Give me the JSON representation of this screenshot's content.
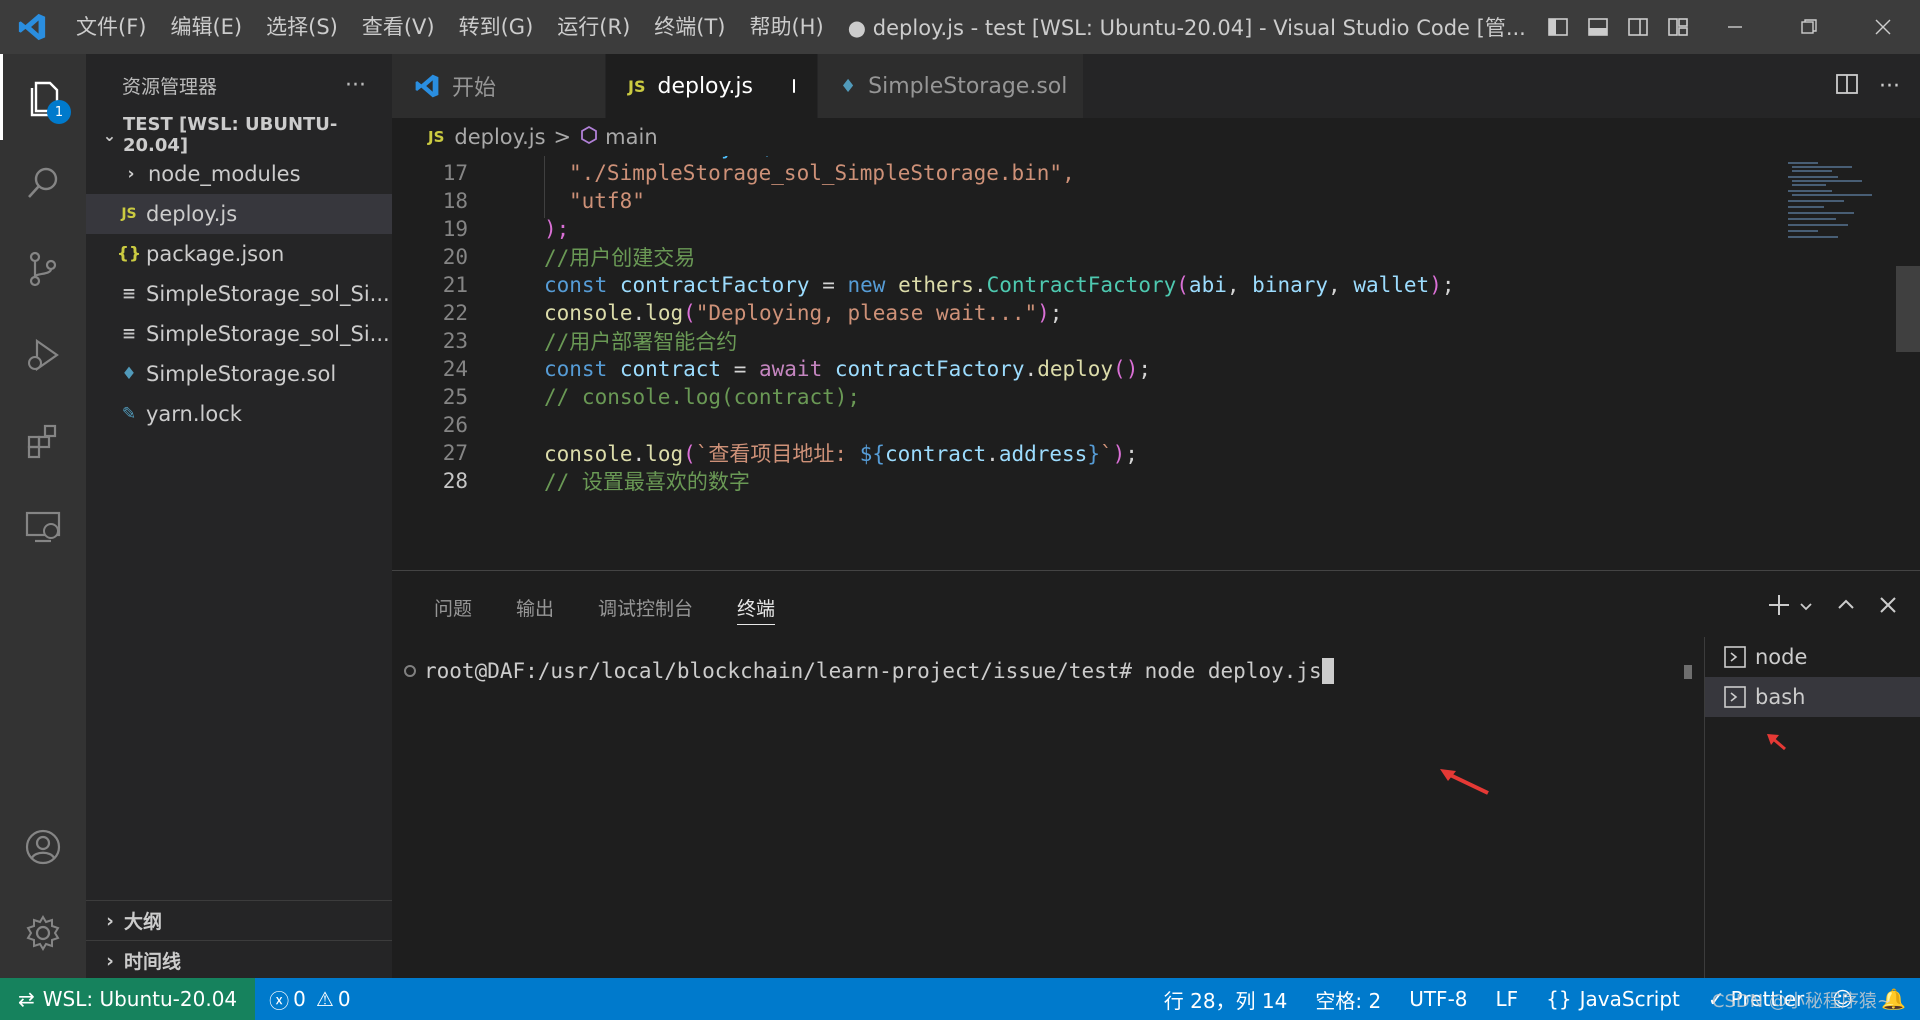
{
  "title_bar": {
    "menus": [
      "文件(F)",
      "编辑(E)",
      "选择(S)",
      "查看(V)",
      "转到(G)",
      "运行(R)",
      "终端(T)",
      "帮助(H)"
    ],
    "title": "● deploy.js - test [WSL: Ubuntu-20.04] - Visual Studio Code [管..."
  },
  "activity_bar": {
    "explorer_badge": "1"
  },
  "sidebar": {
    "header": "资源管理器",
    "more": "···",
    "section": "TEST [WSL: UBUNTU-20.04]",
    "files": [
      {
        "icon": "chevron-right-icon",
        "label": "node_modules"
      },
      {
        "icon": "js-file-icon",
        "label": "deploy.js"
      },
      {
        "icon": "json-file-icon",
        "label": "package.json"
      },
      {
        "icon": "text-file-icon",
        "label": "SimpleStorage_sol_Si..."
      },
      {
        "icon": "text-file-icon",
        "label": "SimpleStorage_sol_Si..."
      },
      {
        "icon": "ethereum-file-icon",
        "label": "SimpleStorage.sol"
      },
      {
        "icon": "yarn-file-icon",
        "label": "yarn.lock"
      }
    ],
    "outline": "大纲",
    "timeline": "时间线"
  },
  "tabs": [
    {
      "label": "开始",
      "icon": "vscode-logo-icon"
    },
    {
      "label": "deploy.js",
      "icon": "js-icon",
      "icon_text": "JS"
    },
    {
      "label": "SimpleStorage.sol",
      "icon": "ethereum-icon"
    }
  ],
  "breadcrumb": {
    "file_icon_text": "JS",
    "file": "deploy.js",
    "separator": ">",
    "symbol": "main"
  },
  "editor": {
    "lines": [
      {
        "n": "17",
        "text": "\"./SimpleStorage_sol_SimpleStorage.bin\","
      },
      {
        "n": "18",
        "text": "\"utf8\""
      },
      {
        "n": "19",
        "text": ");"
      },
      {
        "n": "20",
        "text": "//用户创建交易"
      },
      {
        "n": "21",
        "text": "const contractFactory = new ethers.ContractFactory(abi, binary, wallet);"
      },
      {
        "n": "22",
        "text": "console.log(\"Deploying, please wait...\");"
      },
      {
        "n": "23",
        "text": "//用户部署智能合约"
      },
      {
        "n": "24",
        "text": "const contract = await contractFactory.deploy();"
      },
      {
        "n": "25",
        "text": "// console.log(contract);"
      },
      {
        "n": "26",
        "text": ""
      },
      {
        "n": "27",
        "text": "console.log(`查看项目地址: ${contract.address}`);"
      },
      {
        "n": "28",
        "text": "// 设置最喜欢的数字"
      }
    ],
    "current_line": "28"
  },
  "panel": {
    "tabs": [
      "问题",
      "输出",
      "调试控制台",
      "终端"
    ],
    "active_tab": "终端",
    "terminal_prompt": "root@DAF:/usr/local/blockchain/learn-project/issue/test# ",
    "terminal_command": "node deploy.js",
    "terminals": [
      "node",
      "bash"
    ],
    "selected_terminal": "bash"
  },
  "status_bar": {
    "remote": "WSL: Ubuntu-20.04",
    "errors": "0",
    "warnings": "0",
    "position": "行 28，列 14",
    "spaces": "空格: 2",
    "encoding": "UTF-8",
    "eol": "LF",
    "language": "JavaScript",
    "prettier": "Prettier",
    "watermark": "CSDN @小秘程序猿~"
  },
  "colors": {
    "accent": "#007acc",
    "remote": "#16825d",
    "annotation_arrow": "#e53935"
  }
}
